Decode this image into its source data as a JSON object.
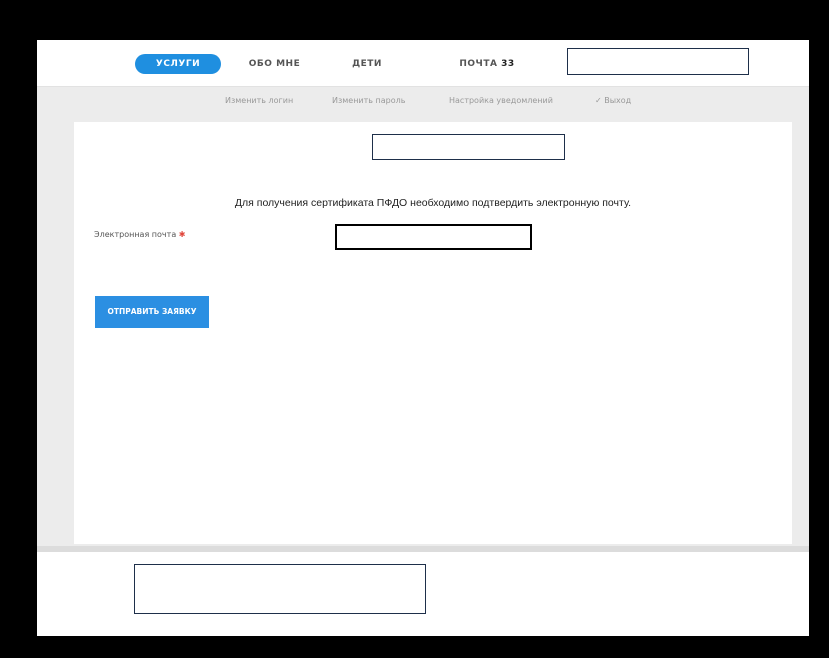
{
  "nav": {
    "items": [
      {
        "label": "УСЛУГИ"
      },
      {
        "label": "ОБО МНЕ"
      },
      {
        "label": "ДЕТИ"
      },
      {
        "label": "ПОЧТА",
        "count": "33"
      }
    ]
  },
  "subnav": {
    "change_login": "Изменить логин",
    "change_password": "Изменить пароль",
    "notification_settings": "Настройка уведомлений",
    "logout": "✓ Выход"
  },
  "main": {
    "message": "Для получения сертификата ПФДО необходимо подтвердить электронную почту.",
    "email_label": "Электронная почта",
    "required_mark": "✱",
    "submit_label": "ОТПРАВИТЬ ЗАЯВКУ"
  },
  "colors": {
    "accent": "#1f8fe0",
    "button": "#2b8fe2",
    "required": "#e0463b"
  }
}
